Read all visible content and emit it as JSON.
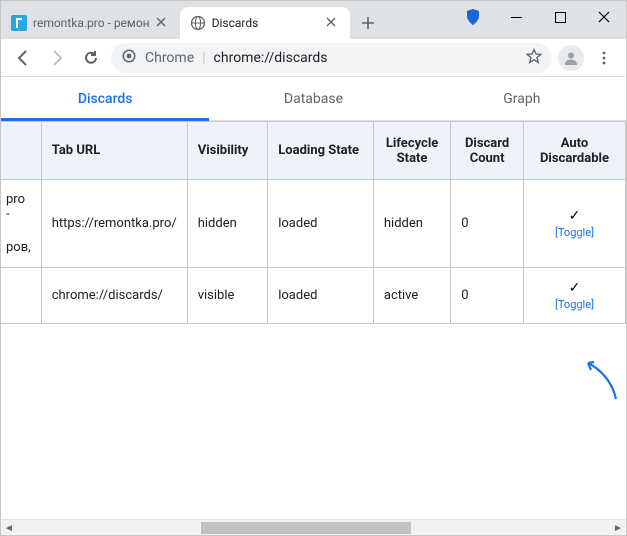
{
  "tabs": [
    {
      "title": "remontka.pro - ремон",
      "favicon_color": "#2aa5e0"
    },
    {
      "title": "Discards"
    }
  ],
  "omnibox": {
    "scheme_label": "Chrome",
    "url": "chrome://discards"
  },
  "page_tabs": {
    "discards": "Discards",
    "database": "Database",
    "graph": "Graph"
  },
  "table": {
    "headers": {
      "tab_url": "Tab URL",
      "visibility": "Visibility",
      "loading_state": "Loading State",
      "lifecycle_state": "Lifecycle State",
      "discard_count": "Discard Count",
      "auto_discardable": "Auto Discardable"
    },
    "rows": [
      {
        "trunc1": "pro -",
        "trunc2": "ров,",
        "url": "https://remontka.pro/",
        "visibility": "hidden",
        "loading": "loaded",
        "lifecycle": "hidden",
        "discard_count": "0",
        "auto_check": "✓",
        "toggle": "[Toggle]"
      },
      {
        "trunc1": "",
        "trunc2": "",
        "url": "chrome://discards/",
        "visibility": "visible",
        "loading": "loaded",
        "lifecycle": "active",
        "discard_count": "0",
        "auto_check": "✓",
        "toggle": "[Toggle]"
      }
    ]
  }
}
